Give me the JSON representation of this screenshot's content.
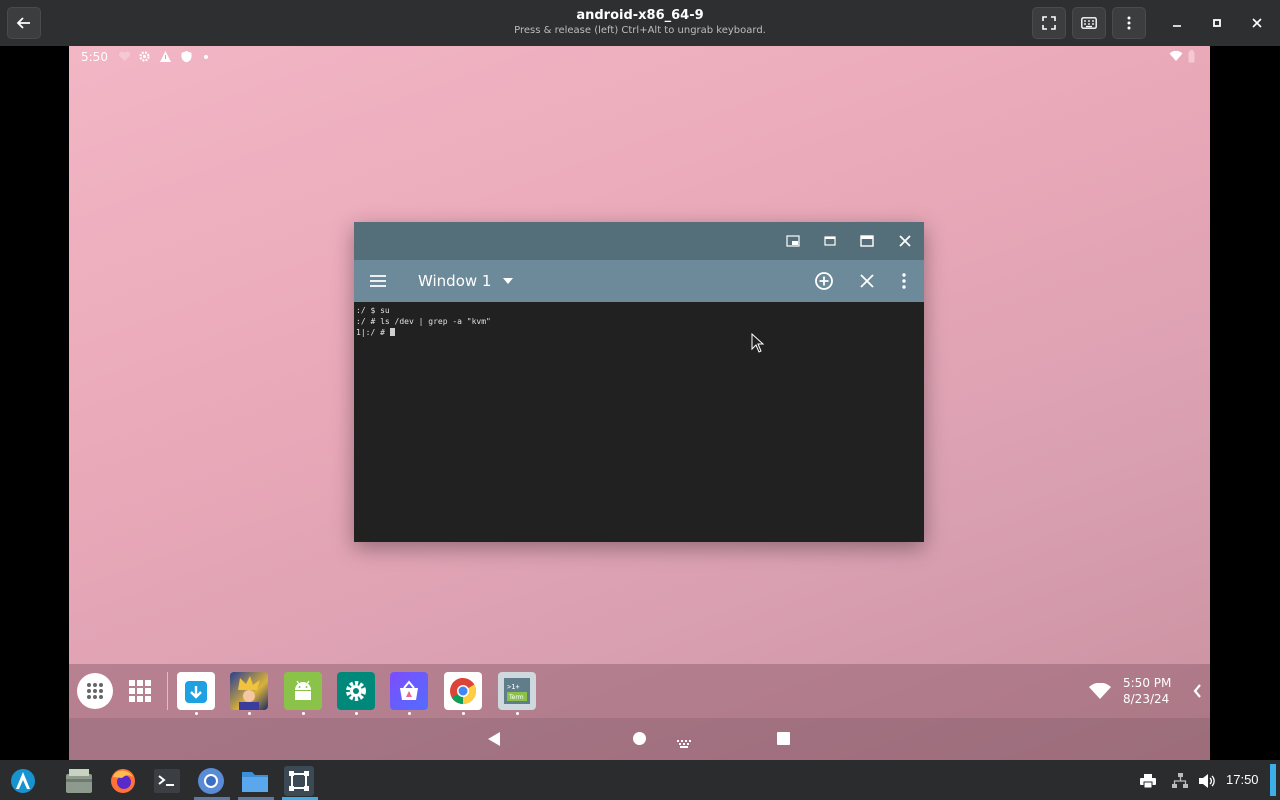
{
  "host_window": {
    "title": "android-x86_64-9",
    "subtitle": "Press & release (left) Ctrl+Alt to ungrab keyboard.",
    "buttons": [
      "back-icon",
      "fullscreen-icon",
      "keyboard-icon",
      "menu-icon",
      "minimize-icon",
      "maximize-icon",
      "close-icon"
    ]
  },
  "status_bar": {
    "time": "5:50"
  },
  "terminal_window": {
    "title": "Window 1",
    "lines": [
      ":/ $ su",
      ":/ # ls /dev | grep -a \"kvm\"",
      "1|:/ # "
    ]
  },
  "taskbar": {
    "apps": [
      "F-Droid",
      "Game",
      "APK Extractor",
      "Settings",
      "App Store",
      "Chrome",
      "Terminal Emulator"
    ],
    "time": "5:50 PM",
    "date": "8/23/24"
  },
  "host_panel": {
    "clock": "17:50"
  },
  "colors": {
    "caption": "#546e7a",
    "toolbar": "#6c8a99",
    "terminal_bg": "#212121",
    "accent": "#3daee9"
  }
}
